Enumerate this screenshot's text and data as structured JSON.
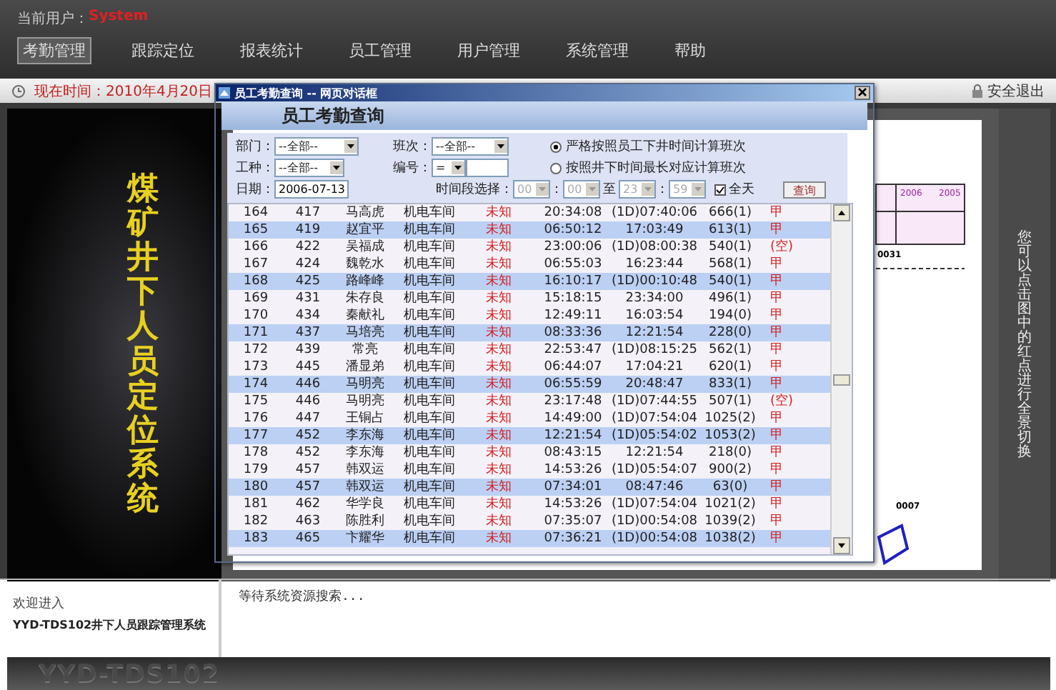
{
  "header": {
    "user_label": "当前用户：",
    "user_name": "System"
  },
  "nav": [
    {
      "label": "考勤管理",
      "selected": true
    },
    {
      "label": "跟踪定位",
      "selected": false
    },
    {
      "label": "报表统计",
      "selected": false
    },
    {
      "label": "员工管理",
      "selected": false
    },
    {
      "label": "用户管理",
      "selected": false
    },
    {
      "label": "系统管理",
      "selected": false
    },
    {
      "label": "帮助",
      "selected": false
    }
  ],
  "time_bar": {
    "time": "现在时间：2010年4月20日",
    "logout": "安全退出"
  },
  "side_banner": {
    "title": "煤矿井下人员定位系统"
  },
  "map": {
    "hint": "您可以点击图中的红点进行全景切换",
    "labels": [
      "2006",
      "2005",
      "0031",
      "0007"
    ]
  },
  "dialog": {
    "title": "员工考勤查询 -- 网页对话框",
    "heading": "员工考勤查询",
    "form": {
      "department": {
        "label": "部门：",
        "value": "--全部--"
      },
      "shift": {
        "label": "班次：",
        "value": "--全部--"
      },
      "job": {
        "label": "工种：",
        "value": "--全部--"
      },
      "number": {
        "label": "编号：",
        "operator": "="
      },
      "date": {
        "label": "日期：",
        "value": "2006-07-13"
      },
      "time_range": {
        "label": "时间段选择：",
        "from_hour": "00",
        "from_separator": "：",
        "from_minute": "00",
        "to_label": "至",
        "to_hour": "23",
        "to_separator": "：",
        "to_minute": "59",
        "disabled": true
      },
      "all_day": {
        "label": "全天",
        "checked": true
      },
      "modes": [
        {
          "label": "严格按照员工下井时间计算班次",
          "selected": true
        },
        {
          "label": "按照井下时间最长对应计算班次",
          "selected": false
        }
      ],
      "query_button": "查询"
    },
    "rows": [
      {
        "cells": [
          "164",
          "417",
          "马高虎",
          "机电车间",
          "未知",
          "20:34:08",
          "(1D)07:40:06",
          "666(1)",
          "甲"
        ]
      },
      {
        "cells": [
          "165",
          "419",
          "赵宜平",
          "机电车间",
          "未知",
          "06:50:12",
          "17:03:49",
          "613(1)",
          "甲"
        ]
      },
      {
        "cells": [
          "166",
          "422",
          "吴福成",
          "机电车间",
          "未知",
          "23:00:06",
          "(1D)08:00:38",
          "540(1)",
          "(空)"
        ]
      },
      {
        "cells": [
          "167",
          "424",
          "魏乾水",
          "机电车间",
          "未知",
          "06:55:03",
          "16:23:44",
          "568(1)",
          "甲"
        ]
      },
      {
        "cells": [
          "168",
          "425",
          "路峰峰",
          "机电车间",
          "未知",
          "16:10:17",
          "(1D)00:10:48",
          "540(1)",
          "甲"
        ]
      },
      {
        "cells": [
          "169",
          "431",
          "朱存良",
          "机电车间",
          "未知",
          "15:18:15",
          "23:34:00",
          "496(1)",
          "甲"
        ]
      },
      {
        "cells": [
          "170",
          "434",
          "秦献礼",
          "机电车间",
          "未知",
          "12:49:11",
          "16:03:54",
          "194(0)",
          "甲"
        ]
      },
      {
        "cells": [
          "171",
          "437",
          "马培亮",
          "机电车间",
          "未知",
          "08:33:36",
          "12:21:54",
          "228(0)",
          "甲"
        ]
      },
      {
        "cells": [
          "172",
          "439",
          "常亮",
          "机电车间",
          "未知",
          "22:53:47",
          "(1D)08:15:25",
          "562(1)",
          "甲"
        ]
      },
      {
        "cells": [
          "173",
          "445",
          "潘显弟",
          "机电车间",
          "未知",
          "06:44:07",
          "17:04:21",
          "620(1)",
          "甲"
        ]
      },
      {
        "cells": [
          "174",
          "446",
          "马明亮",
          "机电车间",
          "未知",
          "06:55:59",
          "20:48:47",
          "833(1)",
          "甲"
        ]
      },
      {
        "cells": [
          "175",
          "446",
          "马明亮",
          "机电车间",
          "未知",
          "23:17:48",
          "(1D)07:44:55",
          "507(1)",
          "(空)"
        ]
      },
      {
        "cells": [
          "176",
          "447",
          "王铜占",
          "机电车间",
          "未知",
          "14:49:00",
          "(1D)07:54:04",
          "1025(2)",
          "甲"
        ]
      },
      {
        "cells": [
          "177",
          "452",
          "李东海",
          "机电车间",
          "未知",
          "12:21:54",
          "(1D)05:54:02",
          "1053(2)",
          "甲"
        ]
      },
      {
        "cells": [
          "178",
          "452",
          "李东海",
          "机电车间",
          "未知",
          "08:43:15",
          "12:21:54",
          "218(0)",
          "甲"
        ]
      },
      {
        "cells": [
          "179",
          "457",
          "韩双运",
          "机电车间",
          "未知",
          "14:53:26",
          "(1D)05:54:07",
          "900(2)",
          "甲"
        ]
      },
      {
        "cells": [
          "180",
          "457",
          "韩双运",
          "机电车间",
          "未知",
          "07:34:01",
          "08:47:46",
          "63(0)",
          "甲"
        ]
      },
      {
        "cells": [
          "181",
          "462",
          "华学良",
          "机电车间",
          "未知",
          "14:53:26",
          "(1D)07:54:04",
          "1021(2)",
          "甲"
        ]
      },
      {
        "cells": [
          "182",
          "463",
          "陈胜利",
          "机电车间",
          "未知",
          "07:35:07",
          "(1D)00:54:08",
          "1039(2)",
          "甲"
        ]
      },
      {
        "cells": [
          "183",
          "465",
          "卞耀华",
          "机电车间",
          "未知",
          "07:36:21",
          "(1D)00:54:08",
          "1038(2)",
          "甲"
        ]
      }
    ]
  },
  "welcome": {
    "line_1": "欢迎进入",
    "line_2": "YYD-TDS102井下人员跟踪管理系统"
  },
  "status": "等待系统资源搜索...",
  "footer": {
    "logo": "YYD-TDS102"
  }
}
